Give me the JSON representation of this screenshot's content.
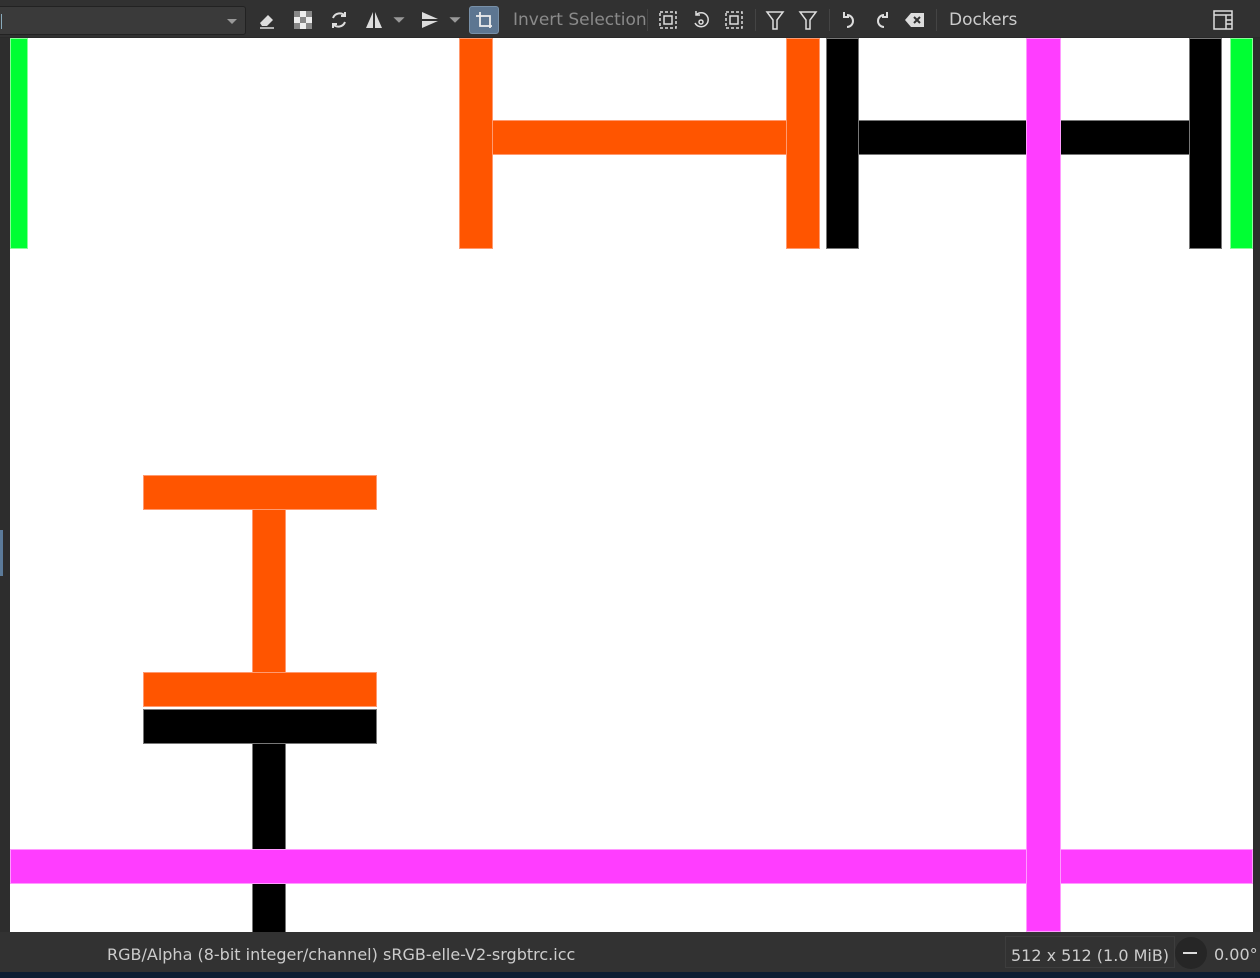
{
  "toolbar": {
    "brush_combo_value": "",
    "invert_selection_label": "Invert Selection",
    "dockers_label": "Dockers",
    "icons": [
      "eraser-icon",
      "alpha-lock-icon",
      "reload-preset-icon",
      "mirror-horizontal-icon",
      "mirror-vertical-icon",
      "wrap-around-icon",
      "select-all-icon",
      "reselect-icon",
      "deselect-icon",
      "filter-icon",
      "filter-reapply-icon",
      "undo-icon",
      "redo-icon",
      "clear-icon",
      "workspace-icon"
    ]
  },
  "canvas": {
    "colors": {
      "orange": "#ff5500",
      "black": "#000000",
      "magenta": "#ff3dff",
      "green": "#00ff33"
    }
  },
  "status": {
    "color_model": "RGB/Alpha (8-bit integer/channel)",
    "profile": "sRGB-elle-V2-srgbtrc.icc",
    "image_size": "512 x 512 (1.0 MiB)",
    "rotation": "0.00°"
  }
}
